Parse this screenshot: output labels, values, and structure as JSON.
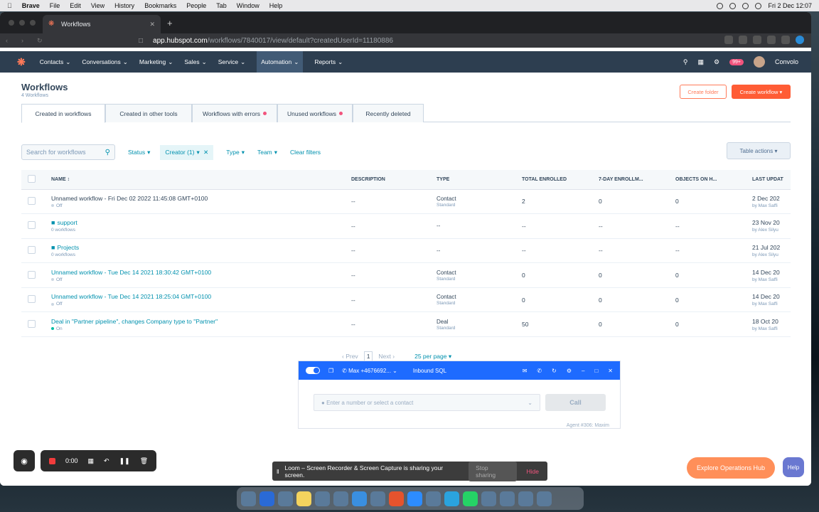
{
  "menubar": {
    "apple": "",
    "app": "Brave",
    "items": [
      "File",
      "Edit",
      "View",
      "History",
      "Bookmarks",
      "People",
      "Tab",
      "Window",
      "Help"
    ],
    "clock": "Fri 2 Dec  12:07"
  },
  "browser": {
    "tab_title": "Workflows",
    "url_domain": "app.hubspot.com",
    "url_path": "/workflows/7840017/view/default?createdUserId=11180886"
  },
  "hubspot_nav": {
    "items": [
      "Contacts",
      "Conversations",
      "Marketing",
      "Sales",
      "Service",
      "Automation",
      "Reports"
    ],
    "active": "Automation",
    "notif_badge": "99+",
    "user": "Convolo"
  },
  "page": {
    "title": "Workflows",
    "subtitle": "4 Workflows",
    "create_folder": "Create folder",
    "create_workflow": "Create workflow"
  },
  "tabs": [
    {
      "label": "Created in workflows",
      "dot": false
    },
    {
      "label": "Created in other tools",
      "dot": false
    },
    {
      "label": "Workflows with errors",
      "dot": true
    },
    {
      "label": "Unused workflows",
      "dot": true
    },
    {
      "label": "Recently deleted",
      "dot": false
    }
  ],
  "filters": {
    "search_placeholder": "Search for workflows",
    "status": "Status",
    "creator": "Creator (1)",
    "type": "Type",
    "team": "Team",
    "clear": "Clear filters",
    "table_actions": "Table actions"
  },
  "table": {
    "headers": [
      "NAME",
      "DESCRIPTION",
      "TYPE",
      "TOTAL ENROLLED",
      "7-DAY ENROLLM...",
      "OBJECTS ON H...",
      "LAST UPDAT"
    ],
    "rows": [
      {
        "name": "Unnamed workflow - Fri Dec 02 2022 11:45:08 GMT+0100",
        "status": "Off",
        "desc": "--",
        "type": "Contact",
        "type_sub": "Standard",
        "total": "2",
        "seven": "0",
        "objects": "0",
        "updated": "2 Dec 202",
        "by": "by Max Saffi"
      },
      {
        "name": "support",
        "status": "0 workflows",
        "desc": "--",
        "type": "--",
        "type_sub": "",
        "total": "--",
        "seven": "--",
        "objects": "--",
        "updated": "23 Nov 20",
        "by": "by Alex Silyu"
      },
      {
        "name": "Projects",
        "status": "0 workflows",
        "desc": "--",
        "type": "--",
        "type_sub": "",
        "total": "--",
        "seven": "--",
        "objects": "--",
        "updated": "21 Jul 202",
        "by": "by Alex Silyu"
      },
      {
        "name": "Unnamed workflow - Tue Dec 14 2021 18:30:42 GMT+0100",
        "status": "Off",
        "desc": "--",
        "type": "Contact",
        "type_sub": "Standard",
        "total": "0",
        "seven": "0",
        "objects": "0",
        "updated": "14 Dec 20",
        "by": "by Max Saffi"
      },
      {
        "name": "Unnamed workflow - Tue Dec 14 2021 18:25:04 GMT+0100",
        "status": "Off",
        "desc": "--",
        "type": "Contact",
        "type_sub": "Standard",
        "total": "0",
        "seven": "0",
        "objects": "0",
        "updated": "14 Dec 20",
        "by": "by Max Saffi"
      },
      {
        "name": "Deal in \"Partner pipeline\", changes Company type to \"Partner\"",
        "status": "On",
        "desc": "--",
        "type": "Deal",
        "type_sub": "Standard",
        "total": "50",
        "seven": "0",
        "objects": "0",
        "updated": "18 Oct 20",
        "by": "by Max Saffi"
      }
    ]
  },
  "pager": {
    "prev": "Prev",
    "page": "1",
    "next": "Next",
    "per_page": "25 per page"
  },
  "dialer": {
    "number": "Max +4676692...",
    "list": "Inbound SQL",
    "placeholder": "Enter a number or select a contact",
    "call": "Call",
    "agent": "Agent #306: Maxim"
  },
  "loom": {
    "time": "0:00",
    "share_text": "Loom – Screen Recorder & Screen Capture is sharing your screen.",
    "stop": "Stop sharing",
    "hide": "Hide"
  },
  "explore": "Explore Operations Hub",
  "help": "Help"
}
